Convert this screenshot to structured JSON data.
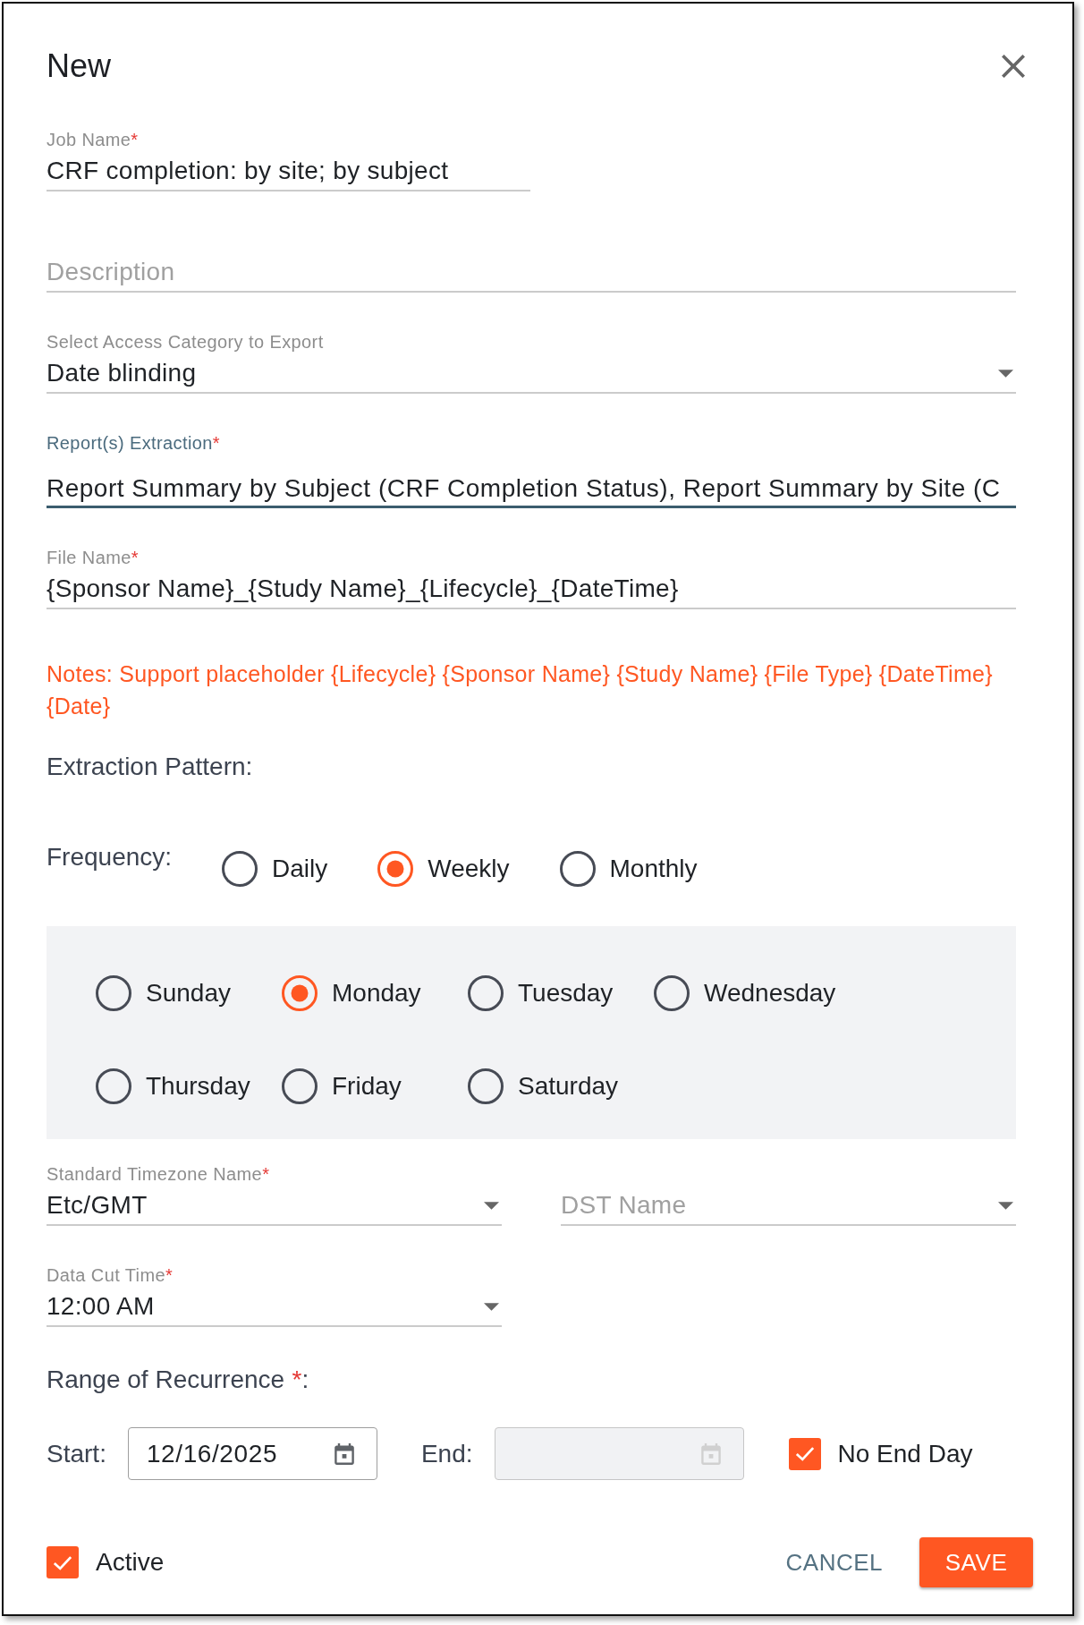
{
  "dialog": {
    "title": "New"
  },
  "fields": [
    {
      "kind": "text",
      "label": "Job Name",
      "required_mark": "*",
      "value": "CRF completion: by site; by subject",
      "focused": false
    },
    {
      "kind": "text",
      "placeholder": "Description",
      "focused": false
    },
    {
      "kind": "select",
      "label": "Select Access Category to Export",
      "value": "Date blinding",
      "focused": false
    },
    {
      "kind": "multiselect",
      "label": "Report(s) Extraction",
      "required_mark": "*",
      "value": "Report Summary by Subject (CRF Completion Status), Report Summary by Site (C",
      "focused": true
    },
    {
      "kind": "text",
      "label": "File Name",
      "required_mark": "*",
      "value": "{Sponsor Name}_{Study Name}_{Lifecycle}_{DateTime}",
      "focused": false
    }
  ],
  "note": "Notes: Support placeholder {Lifecycle} {Sponsor Name} {Study Name} {File Type} {DateTime} {Date}",
  "extraction_pattern": {
    "heading": "Extraction Pattern:",
    "frequency_label": "Frequency:",
    "frequency_options": [
      {
        "label": "Daily",
        "selected": false
      },
      {
        "label": "Weekly",
        "selected": true
      },
      {
        "label": "Monthly",
        "selected": false
      }
    ],
    "day_options": [
      {
        "label": "Sunday",
        "selected": false
      },
      {
        "label": "Monday",
        "selected": true
      },
      {
        "label": "Tuesday",
        "selected": false
      },
      {
        "label": "Wednesday",
        "selected": false
      },
      {
        "label": "Thursday",
        "selected": false
      },
      {
        "label": "Friday",
        "selected": false
      },
      {
        "label": "Saturday",
        "selected": false
      }
    ]
  },
  "schedule_fields": [
    [
      {
        "kind": "select",
        "label": "Standard Timezone Name",
        "required_mark": "*",
        "value": "Etc/GMT"
      },
      {
        "kind": "select",
        "placeholder": "DST Name"
      }
    ],
    [
      {
        "kind": "select",
        "label": "Data Cut Time",
        "required_mark": "*",
        "value": "12:00 AM"
      }
    ]
  ],
  "range_of_recurrence": {
    "heading": "Range of Recurrence",
    "required_mark": "*",
    "heading_end": ":",
    "start": {
      "label": "Start:",
      "value": "12/16/2025",
      "disabled": false
    },
    "end": {
      "label": "End:",
      "disabled": true
    },
    "no_end_day": {
      "label": "No End Day",
      "checked": true
    }
  },
  "active": {
    "label": "Active",
    "checked": true
  },
  "buttons": [
    {
      "kind": "text",
      "label": "CANCEL"
    },
    {
      "kind": "contained",
      "label": "SAVE"
    }
  ]
}
